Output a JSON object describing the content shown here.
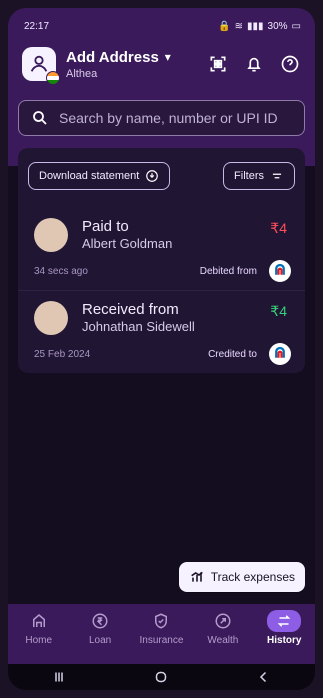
{
  "status_bar": {
    "time": "22:17",
    "battery": "30%"
  },
  "header": {
    "title": "Add Address",
    "subtitle": "Althea"
  },
  "search": {
    "placeholder": "Search by name, number or UPI ID"
  },
  "history": {
    "download_statement": "Download statement",
    "filters": "Filters",
    "transactions": [
      {
        "label": "Paid to",
        "name": "Albert Goldman",
        "amount": "₹4",
        "time": "34 secs ago",
        "direction": "Debited from"
      },
      {
        "label": "Received from",
        "name": "Johnathan Sidewell",
        "amount": "₹4",
        "time": "25 Feb 2024",
        "direction": "Credited to"
      }
    ]
  },
  "track": {
    "label": "Track expenses"
  },
  "bottom_nav": [
    {
      "label": "Home"
    },
    {
      "label": "Loan"
    },
    {
      "label": "Insurance"
    },
    {
      "label": "Wealth"
    },
    {
      "label": "History"
    }
  ],
  "colors": {
    "header_purple": "#3b1a5b",
    "background": "#140d1f",
    "active_nav": "#8d5de6",
    "debit_red": "#ff4d5a",
    "credit_green": "#36d17a"
  },
  "icons": {
    "status": [
      "lock-icon",
      "wifi-icon",
      "signal-icon",
      "battery-icon"
    ],
    "header": [
      "qr-scan-icon",
      "bell-icon",
      "help-icon"
    ],
    "nav": [
      "home-icon",
      "rupee-icon",
      "shield-check-icon",
      "wealth-icon",
      "transfer-icon"
    ]
  }
}
